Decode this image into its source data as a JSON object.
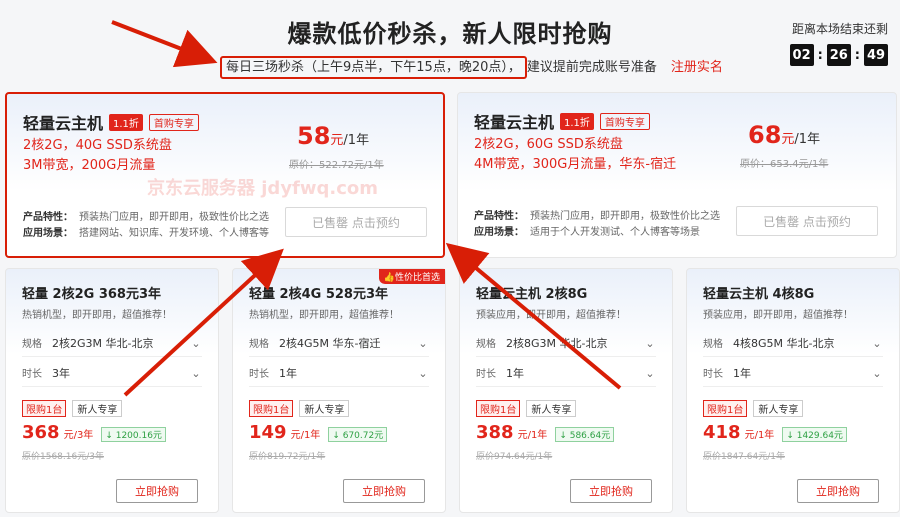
{
  "header": {
    "title": "爆款低价秒杀，新人限时抢购",
    "subtitle_boxed": "每日三场秒杀（上午9点半，下午15点，晚20点），",
    "subtitle_rest": "建议提前完成账号准备",
    "link": "注册实名",
    "countdown_label": "距离本场结束还剩",
    "countdown": [
      "02",
      "26",
      "49"
    ]
  },
  "big_cards": [
    {
      "name": "轻量云主机",
      "discount": "1.1折",
      "tag": "首购专享",
      "spec1": "2核2G，40G SSD系统盘",
      "spec2": "3M带宽，200G月流量",
      "price": "58",
      "unit": "元",
      "per": "/1年",
      "orig": "原价：522.72元/1年",
      "feat_label": "产品特性：",
      "feat": "预装热门应用，即开即用，极致性价比之选",
      "scene_label": "应用场景：",
      "scene": "搭建网站、知识库、开发环境、个人博客等",
      "button": "已售罄 点击预约",
      "watermark": "京东云服务器 jdyfwq.com"
    },
    {
      "name": "轻量云主机",
      "discount": "1.1折",
      "tag": "首购专享",
      "spec1": "2核2G，60G SSD系统盘",
      "spec2": "4M带宽，300G月流量，华东-宿迁",
      "price": "68",
      "unit": "元",
      "per": "/1年",
      "orig": "原价：653.4元/1年",
      "feat_label": "产品特性：",
      "feat": "预装热门应用，即开即用，极致性价比之选",
      "scene_label": "应用场景：",
      "scene": "适用于个人开发测试、个人博客等场景",
      "button": "已售罄 点击预约"
    }
  ],
  "small_cards": [
    {
      "name": "轻量 2核2G 368元3年",
      "desc": "热销机型，即开即用，超值推荐！",
      "spec_label": "规格",
      "spec": "2核2G3M 华北-北京",
      "dur_label": "时长",
      "dur": "3年",
      "limit": "限购1台",
      "newbie": "新人专享",
      "price": "368",
      "unit": "元/3年",
      "save": "1200.16元",
      "orig": "原价1568.16元/3年",
      "button": "立即抢购"
    },
    {
      "name": "轻量 2核4G 528元3年",
      "desc": "热销机型，即开即用，超值推荐！",
      "badge": "性价比首选",
      "spec_label": "规格",
      "spec": "2核4G5M 华东-宿迁",
      "dur_label": "时长",
      "dur": "1年",
      "limit": "限购1台",
      "newbie": "新人专享",
      "price": "149",
      "unit": "元/1年",
      "save": "670.72元",
      "orig": "原价819.72元/1年",
      "button": "立即抢购"
    },
    {
      "name": "轻量云主机 2核8G",
      "desc": "预装应用，即开即用，超值推荐！",
      "spec_label": "规格",
      "spec": "2核8G3M 华北-北京",
      "dur_label": "时长",
      "dur": "1年",
      "limit": "限购1台",
      "newbie": "新人专享",
      "price": "388",
      "unit": "元/1年",
      "save": "586.64元",
      "orig": "原价974.64元/1年",
      "button": "立即抢购"
    },
    {
      "name": "轻量云主机 4核8G",
      "desc": "预装应用，即开即用，超值推荐！",
      "spec_label": "规格",
      "spec": "4核8G5M 华北-北京",
      "dur_label": "时长",
      "dur": "1年",
      "limit": "限购1台",
      "newbie": "新人专享",
      "price": "418",
      "unit": "元/1年",
      "save": "1429.64元",
      "orig": "原价1847.64元/1年",
      "button": "立即抢购"
    }
  ],
  "colors": {
    "accent": "#e1251b",
    "annotation": "#d81e06"
  }
}
